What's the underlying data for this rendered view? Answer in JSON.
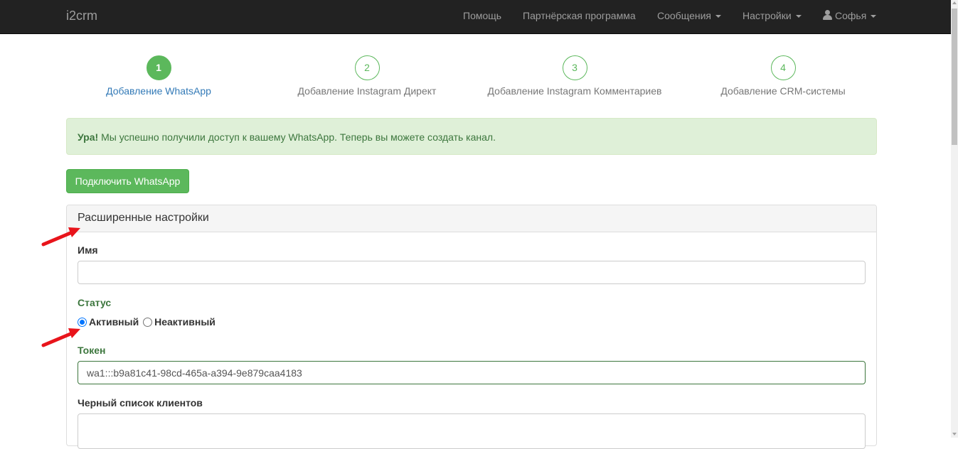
{
  "navbar": {
    "brand": "i2crm",
    "items": [
      {
        "label": "Помощь"
      },
      {
        "label": "Партнёрская программа"
      },
      {
        "label": "Сообщения"
      },
      {
        "label": "Настройки"
      },
      {
        "label": "Софья"
      }
    ]
  },
  "steps": [
    {
      "number": "1",
      "label": "Добавление WhatsApp",
      "active": true
    },
    {
      "number": "2",
      "label": "Добавление Instagram Директ",
      "active": false
    },
    {
      "number": "3",
      "label": "Добавление Instagram Комментариев",
      "active": false
    },
    {
      "number": "4",
      "label": "Добавление CRM-системы",
      "active": false
    }
  ],
  "alert": {
    "strong": "Ура!",
    "text": " Мы успешно получили доступ к вашему WhatsApp. Теперь вы можете создать канал."
  },
  "connect_button": "Подключить WhatsApp",
  "panel": {
    "title": "Расширенные настройки",
    "name_label": "Имя",
    "name_value": "",
    "status_label": "Статус",
    "status_options": [
      {
        "label": "Активный",
        "checked": true
      },
      {
        "label": "Неактивный",
        "checked": false
      }
    ],
    "token_label": "Токен",
    "token_value": "wa1:::b9a81c41-98cd-465a-a394-9e879caa4183",
    "blacklist_label": "Черный список клиентов",
    "blacklist_value": ""
  },
  "colors": {
    "navbar_bg": "#222222",
    "success": "#5cb85c",
    "alert_bg": "#dff0d8",
    "alert_text": "#3c763d",
    "active_step_label": "#337ab7",
    "annotation_arrow": "#e8141b"
  }
}
